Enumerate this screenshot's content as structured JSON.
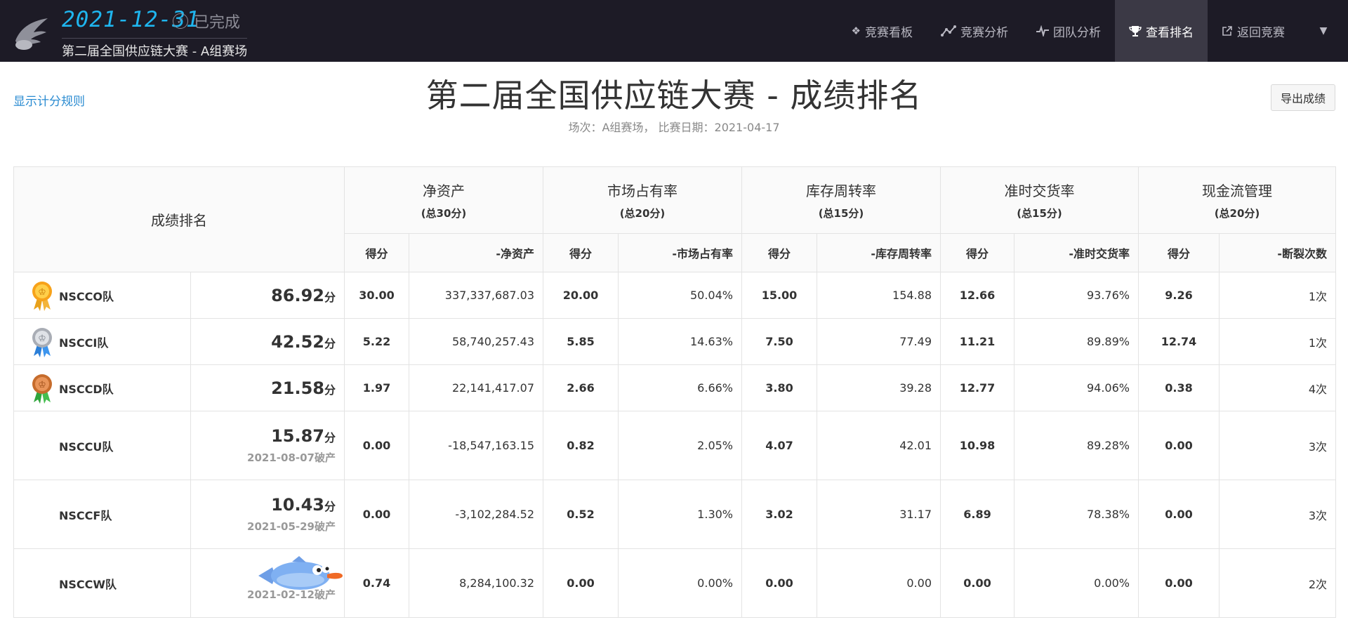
{
  "header": {
    "date": "2021-12-31",
    "status": "已完成",
    "subtitle": "第二届全国供应链大赛 - A组赛场",
    "nav": [
      {
        "label": "竞赛看板",
        "icon": "dashboard-icon"
      },
      {
        "label": "竞赛分析",
        "icon": "chart-icon"
      },
      {
        "label": "团队分析",
        "icon": "pulse-icon"
      },
      {
        "label": "查看排名",
        "icon": "trophy-icon"
      },
      {
        "label": "返回竞赛",
        "icon": "external-link-icon"
      }
    ]
  },
  "page": {
    "rules_link": "显示计分规则",
    "title": "第二届全国供应链大赛 - 成绩排名",
    "sub": "场次：A组赛场， 比赛日期：2021-04-17",
    "export": "导出成绩"
  },
  "table": {
    "rank_header": "成绩排名",
    "groups": [
      {
        "name": "净资产",
        "total": "(总30分)",
        "metric": "-净资产"
      },
      {
        "name": "市场占有率",
        "total": "(总20分)",
        "metric": "-市场占有率"
      },
      {
        "name": "库存周转率",
        "total": "(总15分)",
        "metric": "-库存周转率"
      },
      {
        "name": "准时交货率",
        "total": "(总15分)",
        "metric": "-准时交货率"
      },
      {
        "name": "现金流管理",
        "total": "(总20分)",
        "metric": "-断裂次数"
      }
    ],
    "score_label": "得分",
    "unit": "分",
    "rows": [
      {
        "team": "NSCCO队",
        "medal": "gold",
        "score": "86.92",
        "bankrupt": "",
        "cells": [
          "30.00",
          "337,337,687.03",
          "20.00",
          "50.04%",
          "15.00",
          "154.88",
          "12.66",
          "93.76%",
          "9.26",
          "1次"
        ]
      },
      {
        "team": "NSCCI队",
        "medal": "silver",
        "score": "42.52",
        "bankrupt": "",
        "cells": [
          "5.22",
          "58,740,257.43",
          "5.85",
          "14.63%",
          "7.50",
          "77.49",
          "11.21",
          "89.89%",
          "12.74",
          "1次"
        ]
      },
      {
        "team": "NSCCD队",
        "medal": "bronze",
        "score": "21.58",
        "bankrupt": "",
        "cells": [
          "1.97",
          "22,141,417.07",
          "2.66",
          "6.66%",
          "3.80",
          "39.28",
          "12.77",
          "94.06%",
          "0.38",
          "4次"
        ]
      },
      {
        "team": "NSCCU队",
        "medal": "",
        "score": "15.87",
        "bankrupt": "2021-08-07破产",
        "cells": [
          "0.00",
          "-18,547,163.15",
          "0.82",
          "2.05%",
          "4.07",
          "42.01",
          "10.98",
          "89.28%",
          "0.00",
          "3次"
        ]
      },
      {
        "team": "NSCCF队",
        "medal": "",
        "score": "10.43",
        "bankrupt": "2021-05-29破产",
        "cells": [
          "0.00",
          "-3,102,284.52",
          "0.52",
          "1.30%",
          "3.02",
          "31.17",
          "6.89",
          "78.38%",
          "0.00",
          "3次"
        ]
      },
      {
        "team": "NSCCW队",
        "medal": "fish",
        "score": "",
        "bankrupt": "2021-02-12破产",
        "cells": [
          "0.74",
          "8,284,100.32",
          "0.00",
          "0.00%",
          "0.00",
          "0.00",
          "0.00",
          "0.00%",
          "0.00",
          "2次"
        ]
      }
    ]
  }
}
